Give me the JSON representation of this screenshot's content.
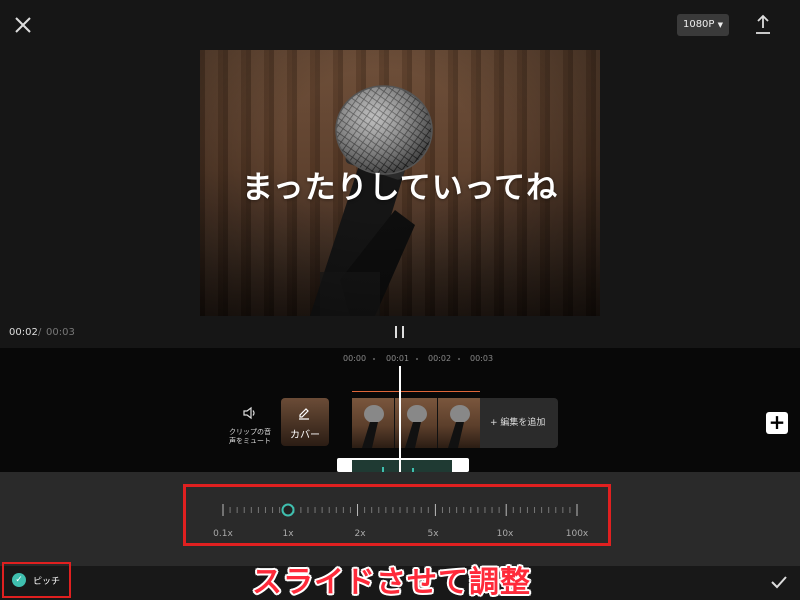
{
  "topbar": {
    "resolution": "1080P",
    "close_icon": "close-icon",
    "export_icon": "export-icon"
  },
  "preview": {
    "caption": "まったりしていってね",
    "image": "microphone"
  },
  "playback": {
    "current_time": "00:02",
    "separator": "/",
    "total_time": "00:03",
    "pause_icon": "pause-icon"
  },
  "timeline": {
    "ruler": [
      "00:00",
      "00:01",
      "00:02",
      "00:03"
    ],
    "mute_label_line1": "クリップの音",
    "mute_label_line2": "声をミュート",
    "cover_label": "カバー",
    "add_edit_label": "+ 編集を追加",
    "add_clip_label": "+"
  },
  "speed": {
    "labels": [
      "0.1x",
      "1x",
      "2x",
      "5x",
      "10x",
      "100x"
    ],
    "selected": "1x"
  },
  "bottom": {
    "pitch_label": "ピッチ",
    "pitch_checked": true,
    "annotation": "スライドさせて調整",
    "confirm_icon": "check-icon"
  },
  "colors": {
    "accent_teal": "#3fbfaf",
    "annotation_red": "#e02020",
    "clip_orange": "#e0673a"
  }
}
